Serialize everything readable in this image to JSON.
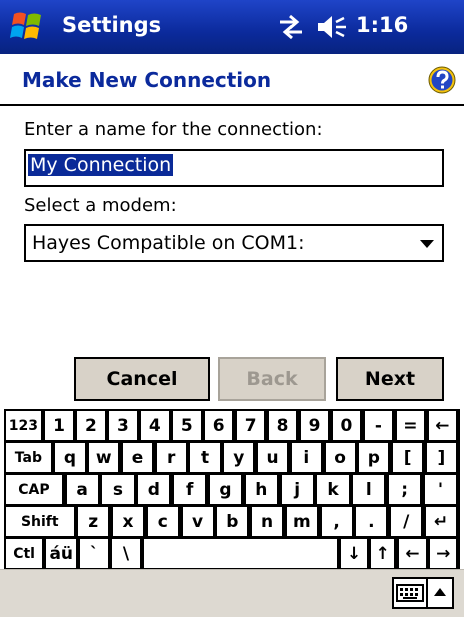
{
  "titlebar": {
    "app_title": "Settings",
    "clock": "1:16"
  },
  "header": {
    "title": "Make New Connection"
  },
  "form": {
    "name_label": "Enter a name for the connection:",
    "name_value": "My Connection",
    "modem_label": "Select a modem:",
    "modem_value": "Hayes Compatible on COM1:"
  },
  "buttons": {
    "cancel": "Cancel",
    "back": "Back",
    "next": "Next"
  },
  "keyboard": {
    "rows": [
      [
        "123",
        "1",
        "2",
        "3",
        "4",
        "5",
        "6",
        "7",
        "8",
        "9",
        "0",
        "-",
        "=",
        "←"
      ],
      [
        "Tab",
        "q",
        "w",
        "e",
        "r",
        "t",
        "y",
        "u",
        "i",
        "o",
        "p",
        "[",
        "]"
      ],
      [
        "CAP",
        "a",
        "s",
        "d",
        "f",
        "g",
        "h",
        "j",
        "k",
        "l",
        ";",
        "'"
      ],
      [
        "Shift",
        "z",
        "x",
        "c",
        "v",
        "b",
        "n",
        "m",
        ",",
        ".",
        "/",
        "↵"
      ],
      [
        "Ctl",
        "áü",
        "`",
        "\\",
        "",
        "↓",
        "↑",
        "←",
        "→"
      ]
    ]
  }
}
